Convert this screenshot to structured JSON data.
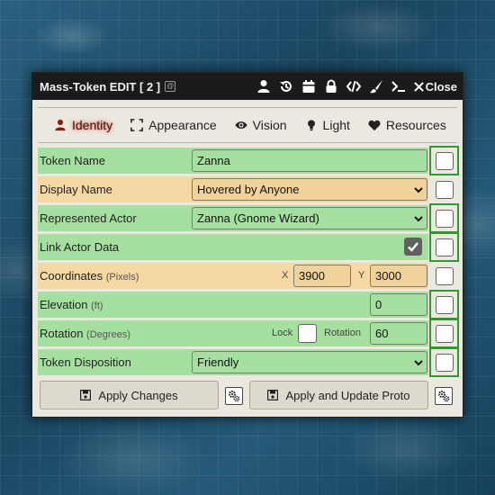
{
  "window": {
    "title": "Mass-Token EDIT [ 2 ]",
    "close_label": "Close",
    "header_icons": [
      "user-icon",
      "history-icon",
      "calendar-icon",
      "lock-icon",
      "code-icon",
      "brush-icon",
      "terminal-icon",
      "close-icon"
    ]
  },
  "tabs": [
    {
      "label": "Identity",
      "icon": "user-icon",
      "active": true
    },
    {
      "label": "Appearance",
      "icon": "expand-icon",
      "active": false
    },
    {
      "label": "Vision",
      "icon": "eye-icon",
      "active": false
    },
    {
      "label": "Light",
      "icon": "lightbulb-icon",
      "active": false
    },
    {
      "label": "Resources",
      "icon": "heart-icon",
      "active": false
    }
  ],
  "fields": {
    "token_name": {
      "label": "Token Name",
      "value": "Zanna"
    },
    "display_name": {
      "label": "Display Name",
      "value": "Hovered by Anyone"
    },
    "represented_actor": {
      "label": "Represented Actor",
      "value": "Zanna (Gnome Wizard)"
    },
    "link_actor_data": {
      "label": "Link Actor Data",
      "checked": true
    },
    "coordinates": {
      "label": "Coordinates",
      "sub": "(Pixels)",
      "x_label": "X",
      "x": "3900",
      "y_label": "Y",
      "y": "3000"
    },
    "elevation": {
      "label": "Elevation",
      "sub": "(ft)",
      "value": "0"
    },
    "rotation": {
      "label": "Rotation",
      "sub": "(Degrees)",
      "lock_label": "Lock",
      "rotation_label": "Rotation",
      "value": "60"
    },
    "token_disposition": {
      "label": "Token Disposition",
      "value": "Friendly"
    }
  },
  "footer": {
    "apply_label": "Apply Changes",
    "apply_proto_label": "Apply and Update Proto"
  },
  "colors": {
    "green_row": "#a6e0a0",
    "orange_row": "#f5d8a4",
    "frame_green": "#2e9a2e",
    "titlebar": "#1b1b1b",
    "active_tab_glow": "#ff6a4d"
  }
}
